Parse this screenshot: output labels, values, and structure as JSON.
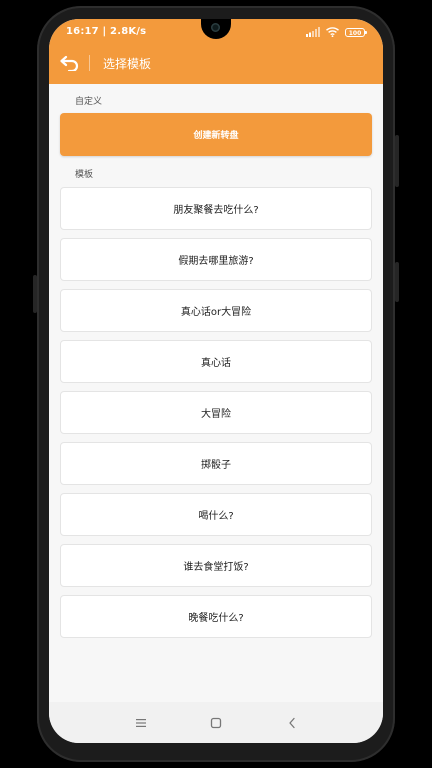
{
  "status_bar": {
    "time": "16:17 | 2.8K/s",
    "battery": "100",
    "icons": [
      "signal-icon",
      "wifi-icon",
      "battery-icon"
    ]
  },
  "app_bar": {
    "back_icon": "back-arrow-icon",
    "title": "选择模板"
  },
  "custom_section": {
    "label": "自定义",
    "create_button": "创建新转盘"
  },
  "template_section": {
    "label": "模板",
    "items": [
      {
        "label": "朋友聚餐去吃什么?"
      },
      {
        "label": "假期去哪里旅游?"
      },
      {
        "label": "真心话or大冒险"
      },
      {
        "label": "真心话"
      },
      {
        "label": "大冒险"
      },
      {
        "label": "掷骰子"
      },
      {
        "label": "喝什么?"
      },
      {
        "label": "谁去食堂打饭?"
      },
      {
        "label": "晚餐吃什么?"
      }
    ]
  },
  "nav_bar": {
    "icons": [
      "menu-icon",
      "home-icon",
      "back-icon"
    ]
  },
  "colors": {
    "accent": "#f39a3c",
    "background": "#f7f7f7",
    "card": "#ffffff"
  }
}
